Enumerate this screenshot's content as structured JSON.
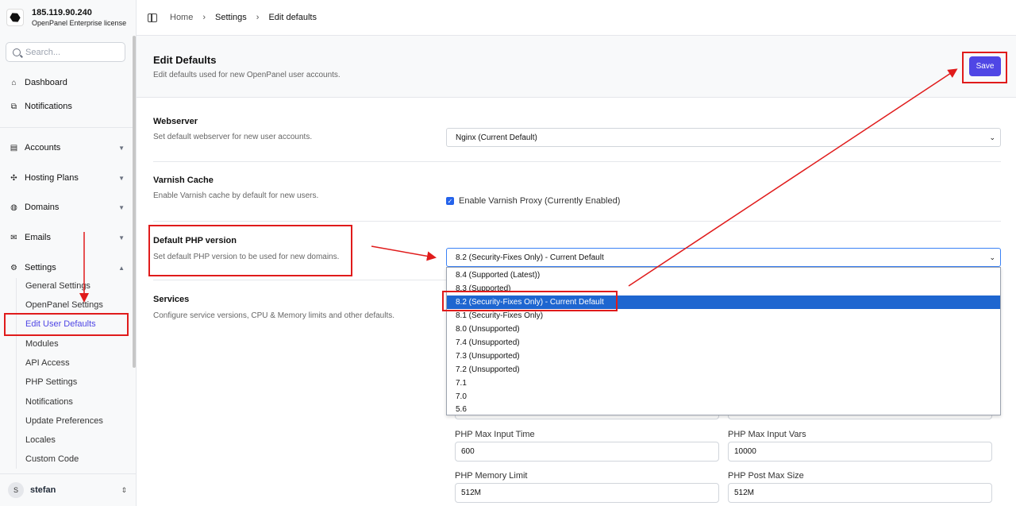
{
  "brand": {
    "ip": "185.119.90.240",
    "license": "OpenPanel Enterprise license"
  },
  "search": {
    "placeholder": "Search..."
  },
  "nav": {
    "dashboard": "Dashboard",
    "notifications": "Notifications",
    "accounts": "Accounts",
    "hosting_plans": "Hosting Plans",
    "domains": "Domains",
    "emails": "Emails",
    "settings": "Settings"
  },
  "settings_sub": [
    "General Settings",
    "OpenPanel Settings",
    "Edit User Defaults",
    "Modules",
    "API Access",
    "PHP Settings",
    "Notifications",
    "Update Preferences",
    "Locales",
    "Custom Code"
  ],
  "user": {
    "initial": "S",
    "name": "stefan"
  },
  "breadcrumb": {
    "home": "Home",
    "settings": "Settings",
    "current": "Edit defaults"
  },
  "page": {
    "title": "Edit Defaults",
    "subtitle": "Edit defaults used for new OpenPanel user accounts.",
    "save": "Save"
  },
  "webserver": {
    "title": "Webserver",
    "desc": "Set default webserver for new user accounts.",
    "value": "Nginx (Current Default)"
  },
  "varnish": {
    "title": "Varnish Cache",
    "desc": "Enable Varnish cache by default for new users.",
    "checkbox": "Enable Varnish Proxy (Currently Enabled)"
  },
  "php": {
    "title": "Default PHP version",
    "desc": "Set default PHP version to be used for new domains.",
    "value": "8.2 (Security-Fixes Only) - Current Default",
    "options": [
      "8.4 (Supported (Latest))",
      "8.3 (Supported)",
      "8.2 (Security-Fixes Only) - Current Default",
      "8.1 (Security-Fixes Only)",
      "8.0 (Unsupported)",
      "7.4 (Unsupported)",
      "7.3 (Unsupported)",
      "7.2 (Unsupported)",
      "7.1",
      "7.0",
      "5.6"
    ],
    "selected_index": 2
  },
  "services": {
    "title": "Services",
    "desc": "Configure service versions, CPU & Memory limits and other defaults."
  },
  "fields": {
    "max_input_time_label": "PHP Max Input Time",
    "max_input_time": "600",
    "max_input_vars_label": "PHP Max Input Vars",
    "max_input_vars": "10000",
    "memory_limit_label": "PHP Memory Limit",
    "memory_limit": "512M",
    "post_max_size_label": "PHP Post Max Size",
    "post_max_size": "512M"
  },
  "colors": {
    "accent": "#4f46e5",
    "annotation": "#e01b1b",
    "selected_option": "#1e66d0"
  }
}
